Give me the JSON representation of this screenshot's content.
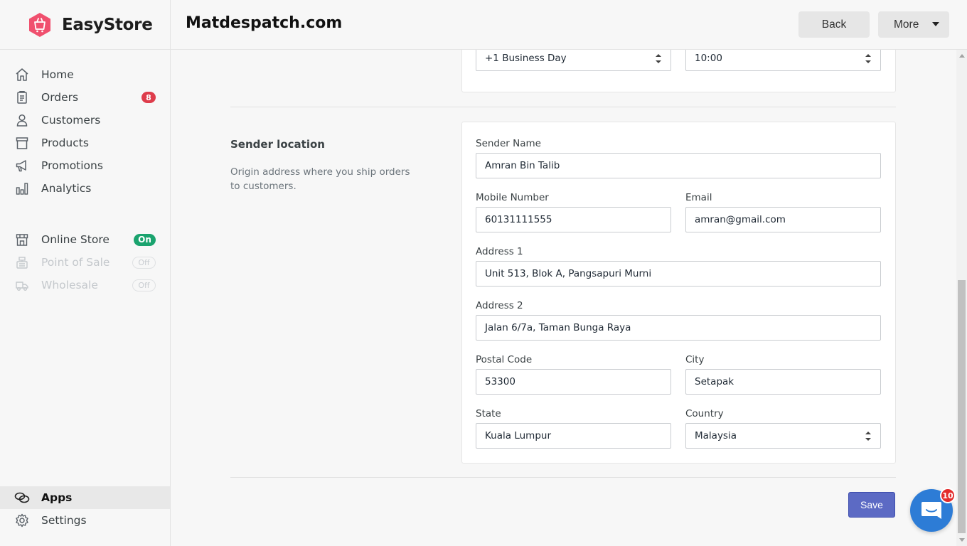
{
  "brand": {
    "name": "EasyStore"
  },
  "sidebar": {
    "items": [
      {
        "label": "Home",
        "icon": "home-icon"
      },
      {
        "label": "Orders",
        "icon": "clipboard-icon",
        "badge": "8"
      },
      {
        "label": "Customers",
        "icon": "person-icon"
      },
      {
        "label": "Products",
        "icon": "box-icon"
      },
      {
        "label": "Promotions",
        "icon": "megaphone-icon"
      },
      {
        "label": "Analytics",
        "icon": "bar-chart-icon"
      }
    ],
    "channels": [
      {
        "label": "Online Store",
        "icon": "storefront-icon",
        "status": "On"
      },
      {
        "label": "Point of Sale",
        "icon": "register-icon",
        "status": "Off"
      },
      {
        "label": "Wholesale",
        "icon": "truck-icon",
        "status": "Off"
      }
    ],
    "bottom": [
      {
        "label": "Apps",
        "icon": "apps-icon"
      },
      {
        "label": "Settings",
        "icon": "gear-icon"
      }
    ]
  },
  "header": {
    "title": "Matdespatch.com",
    "back_label": "Back",
    "more_label": "More"
  },
  "top_card": {
    "pickup_day": "+1 Business Day",
    "pickup_time": "10:00"
  },
  "sender": {
    "section_title": "Sender location",
    "section_desc": "Origin address where you ship orders to customers.",
    "fields": {
      "sender_name": {
        "label": "Sender Name",
        "value": "Amran Bin Talib"
      },
      "mobile": {
        "label": "Mobile Number",
        "value": "60131111555"
      },
      "email": {
        "label": "Email",
        "value": "amran@gmail.com"
      },
      "address1": {
        "label": "Address 1",
        "value": "Unit 513, Blok A, Pangsapuri Murni"
      },
      "address2": {
        "label": "Address 2",
        "value": "Jalan 6/7a, Taman Bunga Raya"
      },
      "postal_code": {
        "label": "Postal Code",
        "value": "53300"
      },
      "city": {
        "label": "City",
        "value": "Setapak"
      },
      "state": {
        "label": "State",
        "value": "Kuala Lumpur"
      },
      "country": {
        "label": "Country",
        "value": "Malaysia"
      }
    }
  },
  "actions": {
    "save_label": "Save"
  },
  "chat": {
    "unread": "10"
  },
  "colors": {
    "brand": "#f0506e",
    "primary": "#5c6ac4",
    "on": "#1aa36e",
    "badge": "#de3c4b",
    "chat": "#2d7cd6"
  }
}
